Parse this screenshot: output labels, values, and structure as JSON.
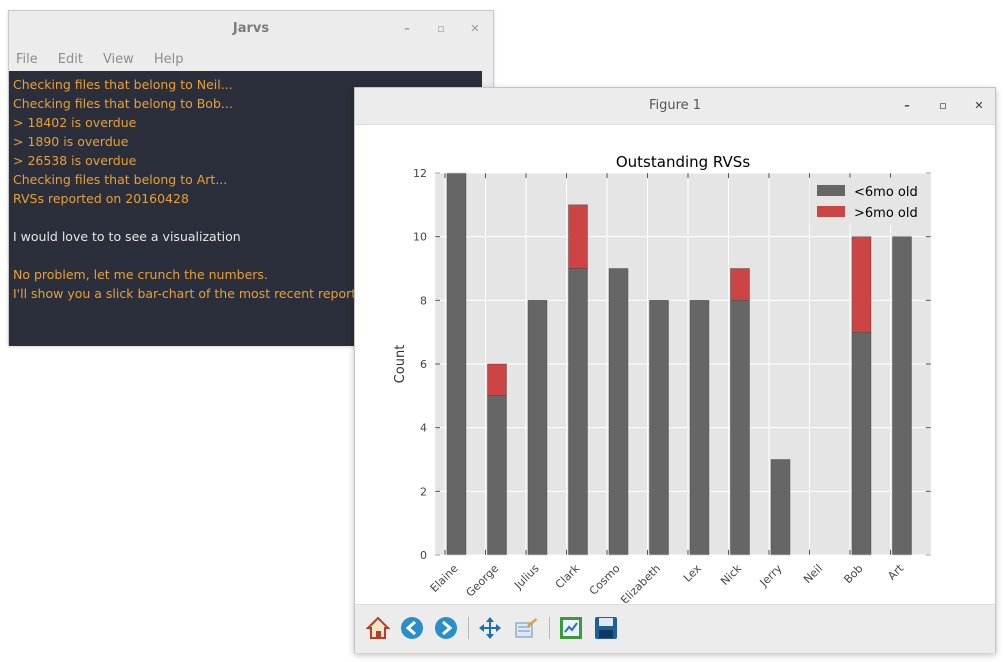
{
  "terminal": {
    "title": "Jarvs",
    "menu": [
      "File",
      "Edit",
      "View",
      "Help"
    ],
    "lines": [
      {
        "text": "Checking files that belong to Neil...",
        "color": "#e8a033"
      },
      {
        "text": "Checking files that belong to Bob...",
        "color": "#e8a033"
      },
      {
        "text": "> 18402 is overdue",
        "color": "#e8a033"
      },
      {
        "text": "> 1890 is overdue",
        "color": "#e8a033"
      },
      {
        "text": "> 26538 is overdue",
        "color": "#e8a033"
      },
      {
        "text": "Checking files that belong to Art...",
        "color": "#e8a033"
      },
      {
        "text": "RVSs reported on 20160428",
        "color": "#e8a033"
      },
      {
        "text": "",
        "color": "#e8a033"
      },
      {
        "text": "I would love to to see a visualization",
        "color": "#e6e6e6"
      },
      {
        "text": "",
        "color": "#e8a033"
      },
      {
        "text": "No problem, let me crunch the numbers.",
        "color": "#e8a033"
      },
      {
        "text": "I'll show you a slick bar-chart of the most recent report.",
        "color": "#e8a033"
      }
    ]
  },
  "figure": {
    "title": "Figure 1",
    "tools": [
      "home-icon",
      "back-icon",
      "forward-icon",
      "pan-icon",
      "zoom-icon",
      "subplots-icon",
      "save-icon"
    ]
  },
  "colors": {
    "console_bg": "#2b2f3b",
    "recent": "#666666",
    "old": "#cc4444",
    "plot_bg": "#e5e5e5"
  },
  "chart_data": {
    "type": "bar",
    "stacked": true,
    "title": "Outstanding RVSs",
    "xlabel": "",
    "ylabel": "Count",
    "ylim": [
      0,
      12
    ],
    "yticks": [
      "0",
      "2",
      "4",
      "6",
      "8",
      "10",
      "12"
    ],
    "grid": true,
    "legend_position": "top-right",
    "categories": [
      "Elaine",
      "George",
      "Julius",
      "Clark",
      "Cosmo",
      "Elizabeth",
      "Lex",
      "Nick",
      "Jerry",
      "Neil",
      "Bob",
      "Art"
    ],
    "series": [
      {
        "name": "<6mo old",
        "color": "#666666",
        "values": [
          12,
          5,
          8,
          9,
          9,
          8,
          8,
          8,
          3,
          0,
          7,
          10
        ]
      },
      {
        "name": ">6mo old",
        "color": "#cc4444",
        "values": [
          0,
          1,
          0,
          2,
          0,
          0,
          0,
          1,
          0,
          0,
          3,
          0
        ]
      }
    ]
  }
}
